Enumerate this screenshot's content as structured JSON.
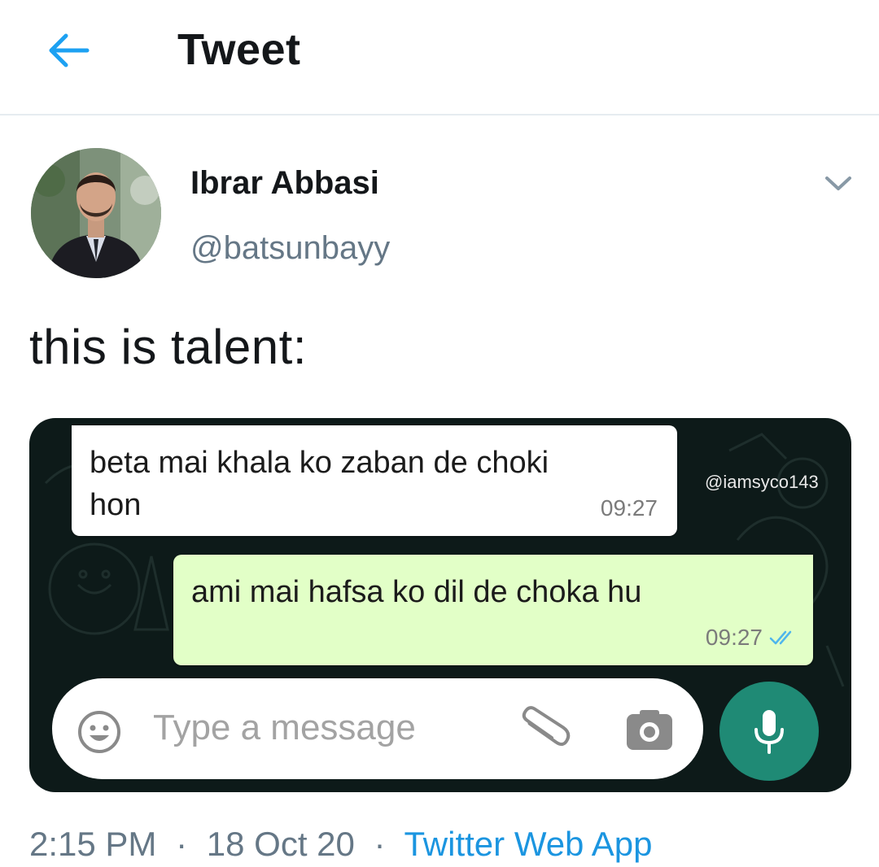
{
  "header": {
    "title": "Tweet",
    "back_icon": "arrow-left-icon"
  },
  "author": {
    "name": "Ibrar Abbasi",
    "handle": "@batsunbayy",
    "more_icon": "chevron-down-icon"
  },
  "tweet": {
    "text": "this is talent:"
  },
  "media": {
    "watermark": "@iamsyco143",
    "messages": [
      {
        "text": "beta mai khala ko zaban de choki hon",
        "time": "09:27",
        "direction": "incoming"
      },
      {
        "text": "ami mai hafsa ko dil de choka hu",
        "time": "09:27",
        "direction": "outgoing",
        "status_icon": "double-check-icon"
      }
    ],
    "composer": {
      "placeholder": "Type a message",
      "emoji_icon": "emoji-icon",
      "attach_icon": "paperclip-icon",
      "camera_icon": "camera-icon",
      "mic_icon": "mic-icon"
    }
  },
  "meta": {
    "time": "2:15 PM",
    "date": "18 Oct 20",
    "separator": "·",
    "source": "Twitter Web App"
  },
  "colors": {
    "accent": "#1b95e0",
    "secondary_text": "#657786",
    "chat_background": "#0d1a19",
    "outgoing_bubble": "#e2ffc7",
    "mic_button": "#1f8a75",
    "read_ticks": "#4fb6ec"
  }
}
